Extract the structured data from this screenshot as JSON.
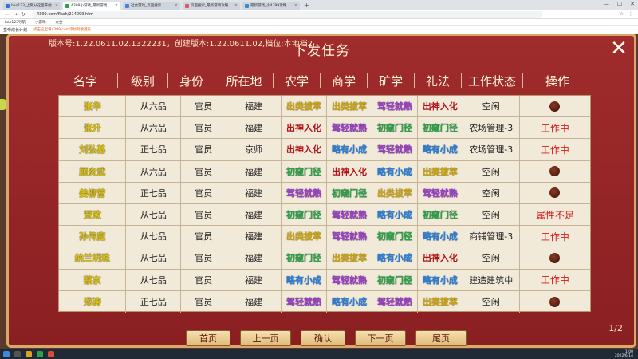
{
  "browser": {
    "tabs": [
      {
        "label": "hao123_上网从这里开始",
        "color": "#3b6fd8",
        "active": false
      },
      {
        "label": "4399小游戏_最新游戏",
        "color": "#2aa24a",
        "active": true
      },
      {
        "label": "社会游戏_页面搜索",
        "color": "#4a7fe0",
        "active": false
      },
      {
        "label": "页面搜索_最新游戏攻略",
        "color": "#e05a5a",
        "active": false
      },
      {
        "label": "最新游戏_小4399攻略",
        "color": "#3a8ad8",
        "active": false
      }
    ],
    "url": "4399.com/flash/214099.htm",
    "bookmarks": [
      "hao123导航",
      "小游戏",
      "大全"
    ],
    "page_label": "皇帝成长计划",
    "page_hint": "点击这里将4399.com添加到收藏夹"
  },
  "game": {
    "version": "版本号:1.22.0611.02.1322231，创建版本:1.22.0611.02,档位:本地档2",
    "title": "下发任务",
    "columns": [
      "名字",
      "级别",
      "身份",
      "所在地",
      "农学",
      "商学",
      "矿学",
      "礼法",
      "工作状态",
      "操作"
    ],
    "rows": [
      {
        "name": "张华",
        "rank": "从六品",
        "identity": "官员",
        "place": "福建",
        "skills": [
          {
            "t": "出类拔萃",
            "c": "yellow"
          },
          {
            "t": "出类拔萃",
            "c": "yellow"
          },
          {
            "t": "驾轻就熟",
            "c": "purple"
          },
          {
            "t": "出神入化",
            "c": "master"
          }
        ],
        "status": "空闲",
        "op": {
          "type": "dot"
        }
      },
      {
        "name": "张升",
        "rank": "从六品",
        "identity": "官员",
        "place": "福建",
        "skills": [
          {
            "t": "出神入化",
            "c": "master"
          },
          {
            "t": "驾轻就熟",
            "c": "purple"
          },
          {
            "t": "初窥门径",
            "c": "green"
          },
          {
            "t": "初窥门径",
            "c": "green"
          }
        ],
        "status": "农场管理-3",
        "op": {
          "type": "text",
          "text": "工作中"
        }
      },
      {
        "name": "刘弘基",
        "rank": "正七品",
        "identity": "官员",
        "place": "京师",
        "skills": [
          {
            "t": "出神入化",
            "c": "master"
          },
          {
            "t": "略有小成",
            "c": "blue"
          },
          {
            "t": "驾轻就熟",
            "c": "purple"
          },
          {
            "t": "略有小成",
            "c": "blue"
          }
        ],
        "status": "农场管理-3",
        "op": {
          "type": "text",
          "text": "工作中"
        }
      },
      {
        "name": "顾炎武",
        "rank": "从六品",
        "identity": "官员",
        "place": "福建",
        "skills": [
          {
            "t": "初窥门径",
            "c": "green"
          },
          {
            "t": "出神入化",
            "c": "master"
          },
          {
            "t": "略有小成",
            "c": "blue"
          },
          {
            "t": "出类拔萃",
            "c": "yellow"
          }
        ],
        "status": "空闲",
        "op": {
          "type": "dot"
        }
      },
      {
        "name": "姜柳营",
        "rank": "正七品",
        "identity": "官员",
        "place": "福建",
        "skills": [
          {
            "t": "驾轻就熟",
            "c": "purple"
          },
          {
            "t": "初窥门径",
            "c": "green"
          },
          {
            "t": "出类拔萃",
            "c": "yellow"
          },
          {
            "t": "驾轻就熟",
            "c": "purple"
          }
        ],
        "status": "空闲",
        "op": {
          "type": "dot"
        }
      },
      {
        "name": "贾政",
        "rank": "从七品",
        "identity": "官员",
        "place": "福建",
        "skills": [
          {
            "t": "初窥门径",
            "c": "green"
          },
          {
            "t": "驾轻就熟",
            "c": "purple"
          },
          {
            "t": "略有小成",
            "c": "blue"
          },
          {
            "t": "初窥门径",
            "c": "green"
          }
        ],
        "status": "空闲",
        "op": {
          "type": "text",
          "text": "属性不足"
        }
      },
      {
        "name": "孙传庭",
        "rank": "从七品",
        "identity": "官员",
        "place": "福建",
        "skills": [
          {
            "t": "出类拔萃",
            "c": "yellow"
          },
          {
            "t": "驾轻就熟",
            "c": "purple"
          },
          {
            "t": "初窥门径",
            "c": "green"
          },
          {
            "t": "略有小成",
            "c": "blue"
          }
        ],
        "status": "商铺管理-3",
        "op": {
          "type": "text",
          "text": "工作中"
        }
      },
      {
        "name": "纳兰明珠",
        "rank": "从七品",
        "identity": "官员",
        "place": "福建",
        "skills": [
          {
            "t": "初窥门径",
            "c": "green"
          },
          {
            "t": "出类拔萃",
            "c": "yellow"
          },
          {
            "t": "略有小成",
            "c": "blue"
          },
          {
            "t": "出神入化",
            "c": "master"
          }
        ],
        "status": "空闲",
        "op": {
          "type": "dot"
        }
      },
      {
        "name": "蔡京",
        "rank": "从七品",
        "identity": "官员",
        "place": "福建",
        "skills": [
          {
            "t": "略有小成",
            "c": "blue"
          },
          {
            "t": "驾轻就熟",
            "c": "purple"
          },
          {
            "t": "初窥门径",
            "c": "green"
          },
          {
            "t": "略有小成",
            "c": "blue"
          }
        ],
        "status": "建造建筑中",
        "op": {
          "type": "text",
          "text": "工作中"
        }
      },
      {
        "name": "郑涛",
        "rank": "正七品",
        "identity": "官员",
        "place": "福建",
        "skills": [
          {
            "t": "驾轻就熟",
            "c": "purple"
          },
          {
            "t": "略有小成",
            "c": "blue"
          },
          {
            "t": "驾轻就熟",
            "c": "purple"
          },
          {
            "t": "出类拔萃",
            "c": "yellow"
          }
        ],
        "status": "空闲",
        "op": {
          "type": "dot"
        }
      }
    ],
    "page_indicator": "1/2",
    "buttons": {
      "first": "首页",
      "prev": "上一页",
      "confirm": "确认",
      "next": "下一页",
      "last": "尾页"
    }
  },
  "taskbar": {
    "time": "1:00",
    "date": "2022/6/14"
  }
}
